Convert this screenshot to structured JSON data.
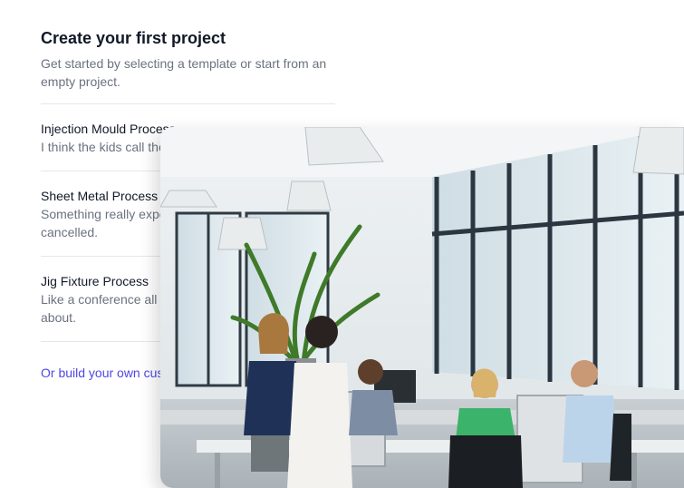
{
  "header": {
    "title": "Create your first project",
    "subtitle": "Get started by selecting a template or start from an empty project."
  },
  "templates": [
    {
      "title": "Injection Mould Process",
      "description": "I think the kids call these memes these days."
    },
    {
      "title": "Sheet Metal Process",
      "description": "Something really expensive that will ultimately get cancelled."
    },
    {
      "title": "Jig Fixture Process",
      "description": "Like a conference all about you that no one will care about."
    }
  ],
  "footer": {
    "link_label": "Or build your own custom project"
  },
  "image": {
    "subject": "office-team-meeting-photo"
  },
  "colors": {
    "accent": "#4f46e5",
    "text": "#111827",
    "muted": "#6b7280",
    "divider": "#e5e7eb"
  }
}
